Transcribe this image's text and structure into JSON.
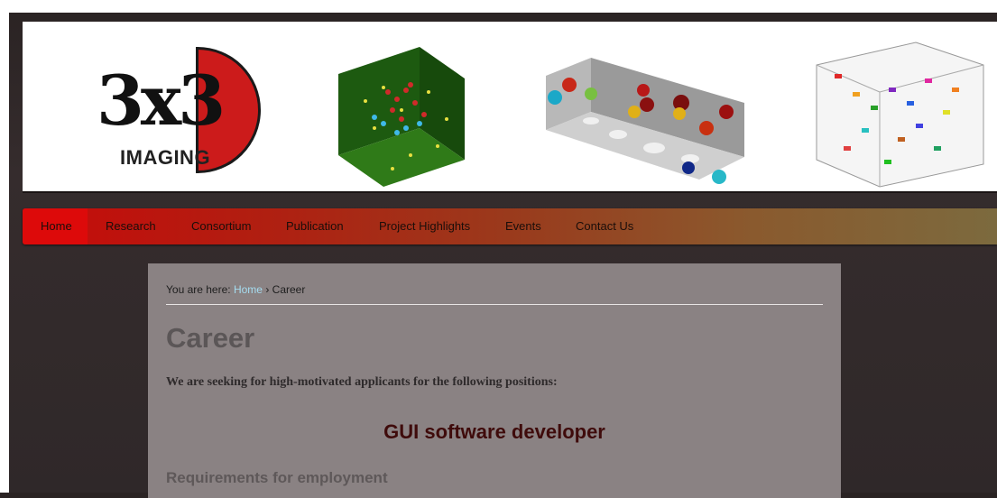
{
  "logo": {
    "text_main": "3x3",
    "text_sub": "IMAGING"
  },
  "nav": {
    "items": [
      "Home",
      "Research",
      "Consortium",
      "Publication",
      "Project Highlights",
      "Events",
      "Contact Us"
    ]
  },
  "breadcrumb": {
    "prefix": "You are here:",
    "home": "Home",
    "separator": "›",
    "current": "Career"
  },
  "page": {
    "title": "Career",
    "intro": "We are seeking for high-motivated applicants for the following positions:",
    "job_title": "GUI software developer",
    "requirements_heading": "Requirements for employment"
  },
  "colors": {
    "brand_red": "#cc1b1b",
    "nav_start": "#c70a0a",
    "link": "#a5dcf0",
    "job_title": "#3f0b0b"
  }
}
